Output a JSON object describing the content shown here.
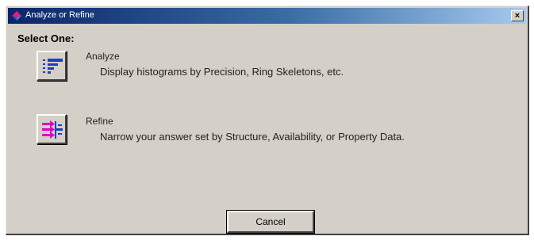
{
  "window": {
    "title": "Analyze or Refine",
    "close_label": "×"
  },
  "dialog": {
    "prompt": "Select One:",
    "options": [
      {
        "label": "Analyze",
        "description": "Display histograms by Precision, Ring Skeletons, etc.",
        "icon": "histogram-icon"
      },
      {
        "label": "Refine",
        "description": "Narrow your answer set by Structure, Availability, or Property Data.",
        "icon": "funnel-arrows-icon"
      }
    ],
    "cancel_label": "Cancel"
  },
  "colors": {
    "title_bar": "#0a246a",
    "dialog_bg": "#d4d0c8",
    "icon_blue": "#1a3fc4",
    "icon_magenta": "#e000c8"
  }
}
